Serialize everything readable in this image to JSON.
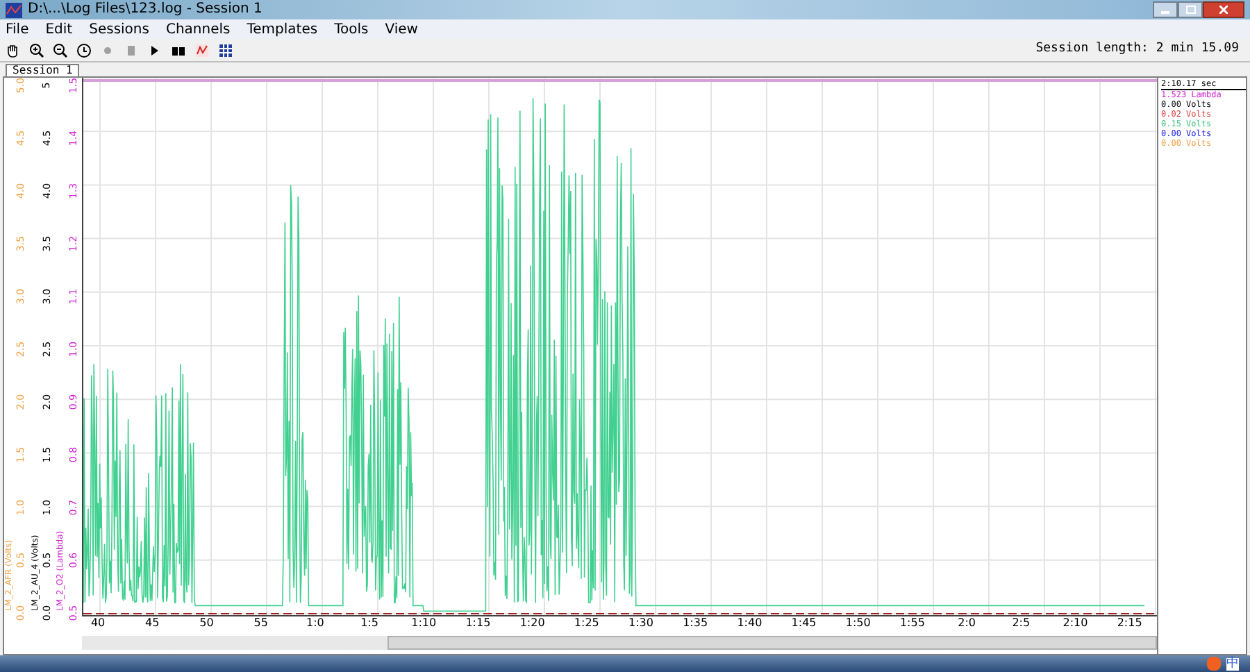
{
  "window": {
    "title": "D:\\...\\Log Files\\123.log - Session 1"
  },
  "menu": [
    "File",
    "Edit",
    "Sessions",
    "Channels",
    "Templates",
    "Tools",
    "View"
  ],
  "toolbar": {
    "session_length": "Session length:  2 min 15.09"
  },
  "tabs": [
    {
      "label": "Session 1",
      "selected": true
    }
  ],
  "axes": [
    {
      "title": "LM_2_AFR (Volts)",
      "color": "#f0a040",
      "ticks": [
        "5.0",
        "4.5",
        "4.0",
        "3.5",
        "3.0",
        "2.5",
        "2.0",
        "1.5",
        "1.0",
        "0.5",
        "0.0"
      ]
    },
    {
      "title": "LM_2_AU_4 (Volts)",
      "color": "#000000",
      "ticks": [
        "5",
        "4.5",
        "4.0",
        "3.5",
        "3.0",
        "2.5",
        "2.0",
        "1.5",
        "1.0",
        "0.5",
        "0.0"
      ]
    },
    {
      "title": "LM_2_O2 (Lambda)",
      "color": "#d020d0",
      "ticks": [
        "1.5",
        "1.4",
        "1.3",
        "1.2",
        "1.1",
        "1.0",
        "0.9",
        "0.8",
        "0.7",
        "0.6",
        "0.5"
      ]
    }
  ],
  "x_labels": [
    "40",
    "45",
    "50",
    "55",
    "1:0",
    "1:5",
    "1:10",
    "1:15",
    "1:20",
    "1:25",
    "1:30",
    "1:35",
    "1:40",
    "1:45",
    "1:50",
    "1:55",
    "2:0",
    "2:5",
    "2:10",
    "2:15"
  ],
  "legend": {
    "time": "2:10.17 sec",
    "readings": [
      {
        "text": "1.523 Lambda",
        "color": "#d020d0"
      },
      {
        "text": "0.00 Volts",
        "color": "#000000"
      },
      {
        "text": "0.02 Volts",
        "color": "#e04040"
      },
      {
        "text": "0.15 Volts",
        "color": "#40c080"
      },
      {
        "text": "0.00 Volts",
        "color": "#2020e0"
      },
      {
        "text": "0.00 Volts",
        "color": "#f0a040"
      }
    ]
  },
  "tray": {
    "ime": "中"
  }
}
